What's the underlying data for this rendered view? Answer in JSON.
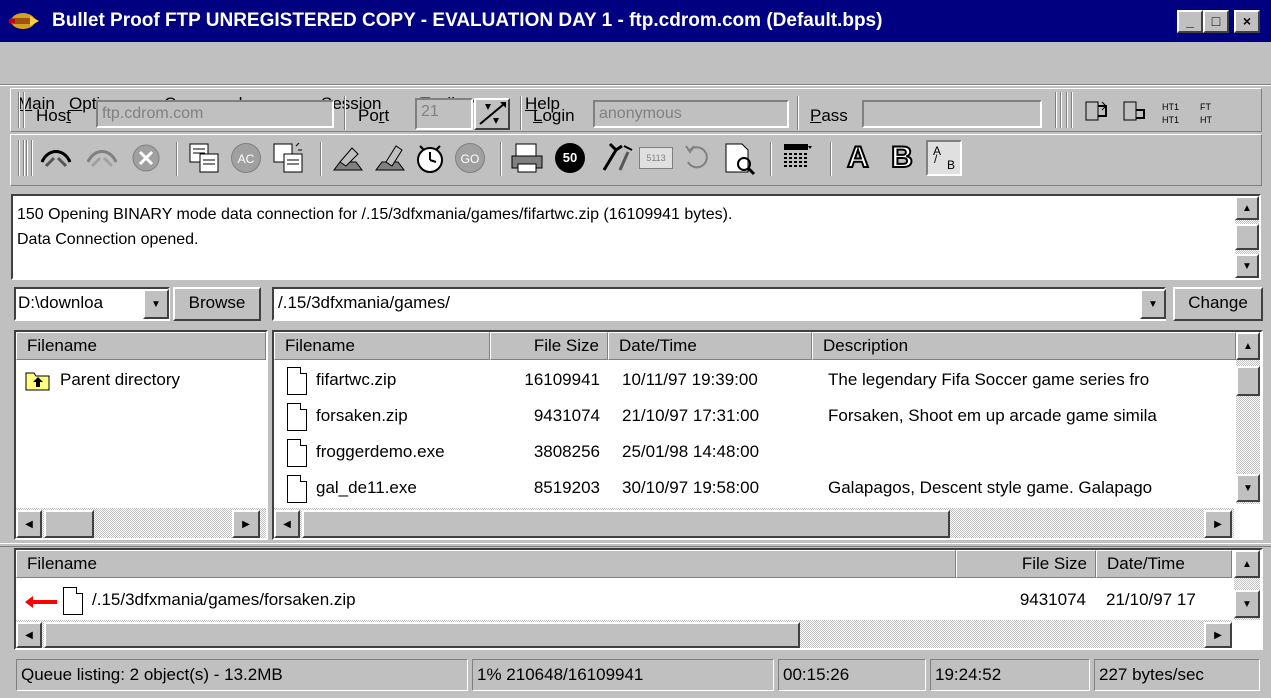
{
  "window": {
    "title": "Bullet Proof FTP UNREGISTERED COPY - EVALUATION DAY 1 - ftp.cdrom.com (Default.bps)",
    "controls": {
      "minimize": "_",
      "maximize": "□",
      "close": "×"
    }
  },
  "menu": {
    "items": [
      {
        "pre": "",
        "key": "M",
        "post": "ain"
      },
      {
        "pre": "",
        "key": "O",
        "post": "ptions"
      },
      {
        "pre": "",
        "key": "C",
        "post": "ommands"
      },
      {
        "pre": "",
        "key": "S",
        "post": "ession"
      },
      {
        "pre": "Tool",
        "key": "b",
        "post": "ars"
      },
      {
        "pre": "",
        "key": "H",
        "post": "elp"
      }
    ]
  },
  "connection": {
    "host_label_pre": "Hos",
    "host_label_key": "t",
    "host_value": "ftp.cdrom.com",
    "port_label_pre": "Po",
    "port_label_key": "r",
    "port_label_post": "t",
    "port_value": "21",
    "login_label_key": "L",
    "login_label_post": "ogin",
    "login_value": "anonymous",
    "pass_label_key": "P",
    "pass_label_post": "ass",
    "pass_value": ""
  },
  "toolbar": {
    "icons": [
      "connect-icon",
      "disconnect-icon",
      "abort-icon",
      "copy-icon",
      "ascii-icon",
      "paste-icon",
      "upload-icon",
      "download-icon",
      "timer-icon",
      "go-icon",
      "print-icon",
      "queue-50-icon",
      "tools-icon",
      "keyboard-icon",
      "refresh-icon",
      "preview-icon",
      "list-view-icon",
      "font-a-icon",
      "font-b-icon",
      "font-ab-icon"
    ],
    "ascii_label": "AC",
    "go_label": "GO",
    "count_label": "50",
    "keys_label": "5113",
    "font_a": "A",
    "font_b": "B",
    "font_ab_top": "A",
    "font_ab_bottom": "B"
  },
  "log": {
    "lines": [
      "150 Opening BINARY mode data connection for /.15/3dfxmania/games/fifartwc.zip (16109941 bytes).",
      "Data Connection opened."
    ]
  },
  "local": {
    "path": "D:\\downloa",
    "browse_label": "Browse",
    "header": "Filename",
    "items": [
      "Parent directory"
    ]
  },
  "remote": {
    "path": "/.15/3dfxmania/games/",
    "change_label": "Change",
    "headers": [
      "Filename",
      "File Size",
      "Date/Time",
      "Description"
    ],
    "rows": [
      {
        "name": "fifartwc.zip",
        "size": "16109941",
        "date": "10/11/97 19:39:00",
        "desc": "The legendary Fifa Soccer game series fro"
      },
      {
        "name": "forsaken.zip",
        "size": "9431074",
        "date": "21/10/97 17:31:00",
        "desc": "Forsaken, Shoot em up arcade game simila"
      },
      {
        "name": "froggerdemo.exe",
        "size": "3808256",
        "date": "25/01/98 14:48:00",
        "desc": ""
      },
      {
        "name": "gal_de11.exe",
        "size": "8519203",
        "date": "30/10/97 19:58:00",
        "desc": "Galapagos, Descent style game. Galapago"
      }
    ]
  },
  "queue": {
    "headers": [
      "Filename",
      "File Size",
      "Date/Time"
    ],
    "rows": [
      {
        "name": "/.15/3dfxmania/games/forsaken.zip",
        "size": "9431074",
        "date": "21/10/97 17"
      }
    ]
  },
  "status": {
    "queue": "Queue listing: 2 object(s) - 13.2MB",
    "progress": "1% 210648/16109941",
    "elapsed": "00:15:26",
    "remaining": "19:24:52",
    "rate": "227 bytes/sec"
  },
  "colors": {
    "titlebar": "#000080",
    "face": "#c0c0c0",
    "queue_arrow": "#ff0000"
  }
}
